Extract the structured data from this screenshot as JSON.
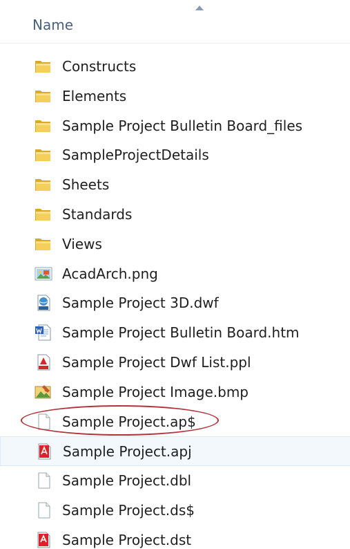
{
  "header": {
    "name_column": "Name"
  },
  "files": [
    {
      "name": "Constructs",
      "icon": "folder-icon"
    },
    {
      "name": "Elements",
      "icon": "folder-icon"
    },
    {
      "name": "Sample Project Bulletin Board_files",
      "icon": "folder-icon"
    },
    {
      "name": "SampleProjectDetails",
      "icon": "folder-icon"
    },
    {
      "name": "Sheets",
      "icon": "folder-icon"
    },
    {
      "name": "Standards",
      "icon": "folder-icon"
    },
    {
      "name": "Views",
      "icon": "folder-icon"
    },
    {
      "name": "AcadArch.png",
      "icon": "png-image-icon"
    },
    {
      "name": "Sample Project 3D.dwf",
      "icon": "dwf-file-icon"
    },
    {
      "name": "Sample Project Bulletin Board.htm",
      "icon": "word-htm-icon"
    },
    {
      "name": "Sample Project Dwf List.ppl",
      "icon": "ppl-file-icon"
    },
    {
      "name": "Sample Project Image.bmp",
      "icon": "bmp-image-icon"
    },
    {
      "name": "Sample Project.ap$",
      "icon": "blank-file-icon"
    },
    {
      "name": "Sample Project.apj",
      "icon": "apj-file-icon"
    },
    {
      "name": "Sample Project.dbl",
      "icon": "blank-file-icon"
    },
    {
      "name": "Sample Project.ds$",
      "icon": "blank-file-icon"
    },
    {
      "name": "Sample Project.dst",
      "icon": "dst-file-icon"
    }
  ],
  "selected_index": 13,
  "annotated_index": 12,
  "colors": {
    "header_text": "#4c607a",
    "file_text": "#1e1e1e",
    "highlight_ring": "#b3313b",
    "selection_bg": "#f3f8fd"
  }
}
